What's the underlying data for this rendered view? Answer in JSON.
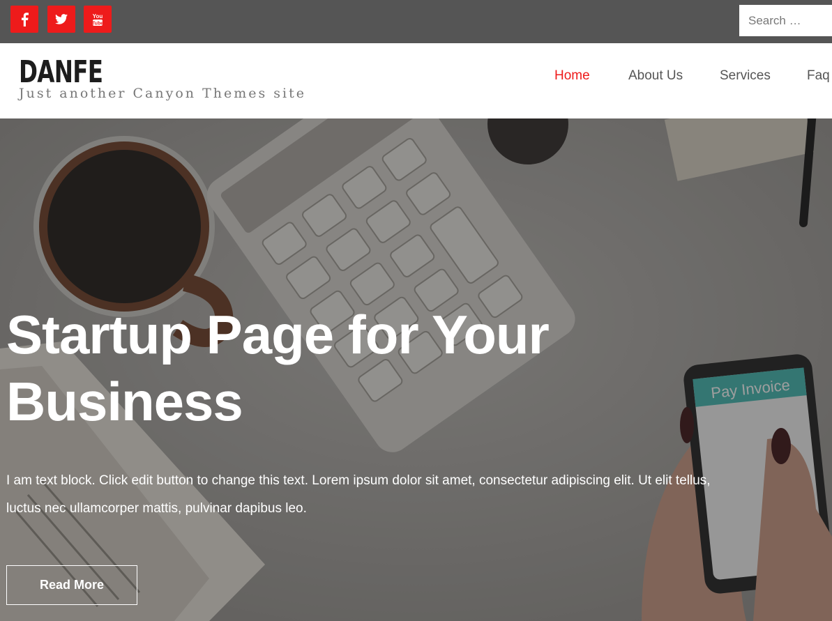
{
  "topbar": {
    "social": [
      {
        "name": "facebook-icon",
        "glyph": "f"
      },
      {
        "name": "twitter-icon",
        "glyph": "twitter"
      },
      {
        "name": "youtube-icon",
        "glyph": "You Tube"
      }
    ],
    "search_placeholder": "Search …",
    "accent": "#ee1b1b"
  },
  "header": {
    "site_title": "DANFE",
    "tagline": "Just another Canyon Themes site",
    "nav": [
      {
        "label": "Home",
        "active": true
      },
      {
        "label": "About Us",
        "active": false
      },
      {
        "label": "Services",
        "active": false
      },
      {
        "label": "Faq",
        "active": false
      }
    ]
  },
  "hero": {
    "title_line1": "Startup Page for Your",
    "title_line2": "Business",
    "text": "I am text block. Click edit button to change this text. Lorem ipsum dolor sit amet, consectetur adipiscing elit. Ut elit tellus, luctus nec ullamcorper mattis, pulvinar dapibus leo.",
    "button_label": "Read More",
    "phone_screen_text": "Pay Invoice"
  }
}
